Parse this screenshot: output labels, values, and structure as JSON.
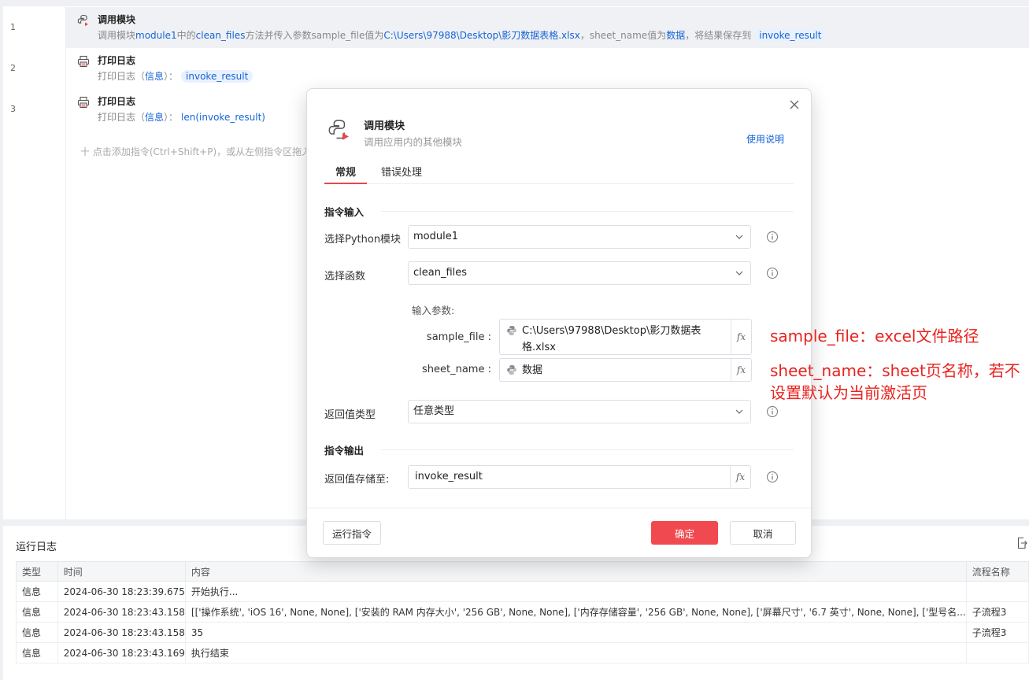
{
  "editor": {
    "steps": [
      {
        "line": "1",
        "title": "调用模块",
        "desc_parts": [
          "调用模块",
          "module1",
          "中的",
          "clean_files",
          "方法并传入参数sample_file值为",
          "C:\\Users\\97988\\Desktop\\影刀数据表格.xlsx",
          "，sheet_name值为",
          "数据",
          "，将结果保存到",
          "invoke_result"
        ]
      },
      {
        "line": "2",
        "title": "打印日志",
        "desc_prefix": "打印日志（",
        "desc_key": "信息",
        "desc_mid": "）：",
        "desc_value": "invoke_result"
      },
      {
        "line": "3",
        "title": "打印日志",
        "desc_prefix": "打印日志（",
        "desc_key": "信息",
        "desc_mid": "）：",
        "desc_value": "len(invoke_result)"
      }
    ],
    "add_hint": "十  点击添加指令(Ctrl+Shift+P)，或从左侧指令区拖入"
  },
  "log": {
    "title": "运行日志",
    "columns": [
      "类型",
      "时间",
      "内容",
      "流程名称"
    ],
    "rows": [
      [
        "信息",
        "2024-06-30 18:23:39.675",
        "开始执行...",
        ""
      ],
      [
        "信息",
        "2024-06-30 18:23:43.158",
        "[['操作系统', 'iOS 16', None, None], ['安装的 RAM 内存大小', '256 GB', None, None], ['内存存储容量', '256 GB', None, None], ['屏幕尺寸', '6.7 英寸', None, None], ['型号名...",
        "子流程3"
      ],
      [
        "信息",
        "2024-06-30 18:23:43.158",
        "35",
        "子流程3"
      ],
      [
        "信息",
        "2024-06-30 18:23:43.169",
        "执行结束",
        ""
      ]
    ]
  },
  "modal": {
    "title": "调用模块",
    "subtitle": "调用应用内的其他模块",
    "help": "使用说明",
    "tabs": [
      "常规",
      "错误处理"
    ],
    "section_input": "指令输入",
    "module_label": "选择Python模块",
    "module_value": "module1",
    "func_label": "选择函数",
    "func_value": "clean_files",
    "params_label": "输入参数:",
    "params": [
      {
        "name": "sample_file :",
        "value": "C:\\Users\\97988\\Desktop\\影刀数据表格.xlsx"
      },
      {
        "name": "sheet_name :",
        "value": "数据"
      }
    ],
    "return_type_label": "返回值类型",
    "return_type_value": "任意类型",
    "section_output": "指令输出",
    "store_label": "返回值存储至:",
    "store_value": "invoke_result",
    "fx": "fx",
    "run_button": "运行指令",
    "ok_button": "确定",
    "cancel_button": "取消"
  },
  "annotations": {
    "sample_file": "sample_file：excel文件路径",
    "sheet_name_1": "sheet_name：sheet页名称，若不",
    "sheet_name_2": "设置默认为当前激活页"
  },
  "colors": {
    "accent": "#1664d8",
    "danger": "#f0494f",
    "annotation": "#e8231f"
  }
}
